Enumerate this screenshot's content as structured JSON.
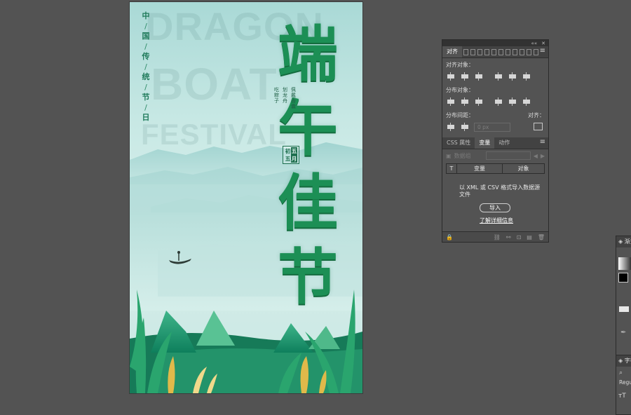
{
  "poster": {
    "side_text": [
      "中",
      "国",
      "传",
      "统",
      "节",
      "日"
    ],
    "watermark_lines": [
      "DRAGON",
      "BOAT",
      "FESTIVAL"
    ],
    "title_chars": [
      "端",
      "午",
      "佳",
      "节"
    ],
    "subtitle_cols": [
      "吃粽子",
      "划龙舟",
      "佩戴香囊"
    ],
    "stamp_chars": [
      "五月",
      "初五"
    ]
  },
  "align_panel": {
    "tabs": [
      "对齐"
    ],
    "align_objects_label": "对齐对象：",
    "distribute_objects_label": "分布对象：",
    "distribute_spacing_label": "分布间距：",
    "spacing_value": "0 px",
    "align_to_label": "对齐："
  },
  "variables_panel": {
    "tabs": [
      "CSS 属性",
      "变量",
      "动作"
    ],
    "dataset_placeholder": "数据组",
    "col_variable": "变量",
    "col_object": "对象",
    "import_message": "以 XML 或 CSV 格式导入数据源文件",
    "import_button": "导入",
    "learn_more": "了解详细信息"
  },
  "side_panels": {
    "gradient_title": "渐变",
    "character_title": "字符",
    "font_style": "Regu"
  },
  "colors": {
    "workspace": "#535353",
    "panel_bg": "#535353",
    "title_green": "#1c8f55"
  }
}
